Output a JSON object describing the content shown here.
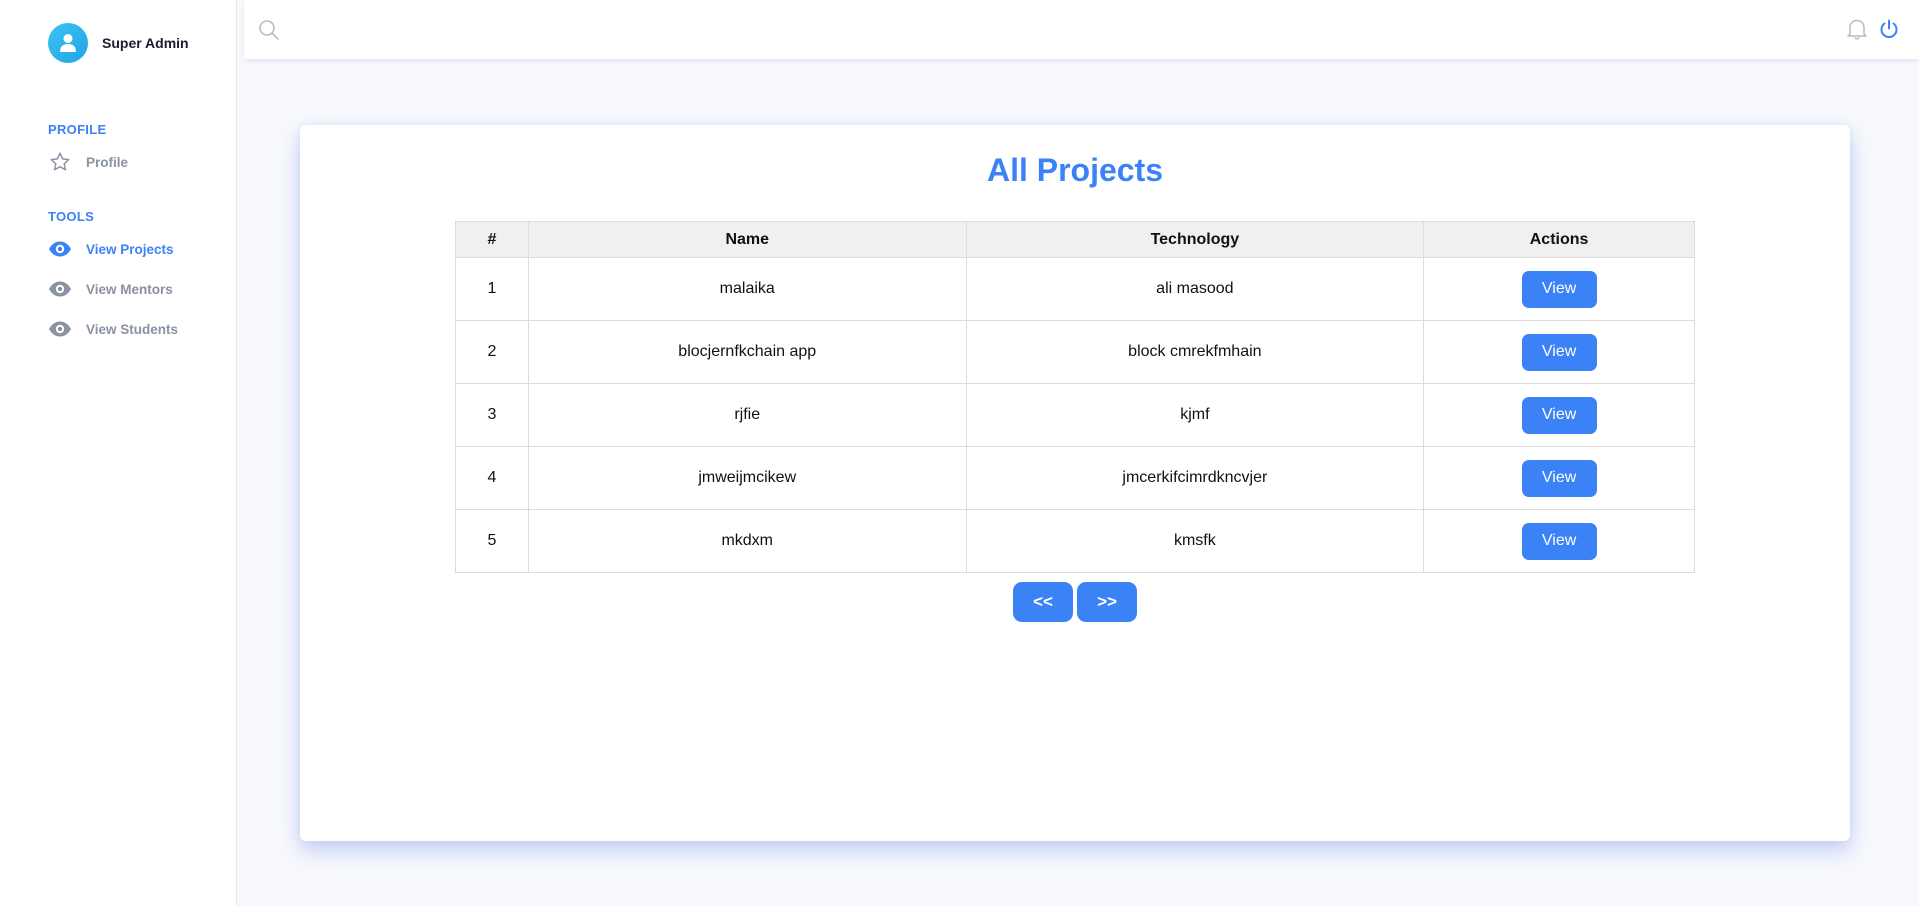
{
  "sidebar": {
    "user_name": "Super Admin",
    "sections": [
      {
        "title": "PROFILE"
      },
      {
        "title": "TOOLS"
      }
    ],
    "items": [
      {
        "label": "Profile",
        "icon": "star-icon",
        "active": false
      },
      {
        "label": "View Projects",
        "icon": "eye-icon",
        "active": true
      },
      {
        "label": "View Mentors",
        "icon": "eye-icon",
        "active": false
      },
      {
        "label": "View Students",
        "icon": "eye-icon",
        "active": false
      }
    ]
  },
  "topbar": {
    "icons": [
      "search-icon",
      "bell-icon",
      "power-icon"
    ]
  },
  "main": {
    "title": "All Projects",
    "table": {
      "headers": [
        "#",
        "Name",
        "Technology",
        "Actions"
      ],
      "rows": [
        {
          "num": "1",
          "name": "malaika",
          "technology": "ali masood",
          "action": "View"
        },
        {
          "num": "2",
          "name": "blocjernfkchain app",
          "technology": "block cmrekfmhain",
          "action": "View"
        },
        {
          "num": "3",
          "name": "rjfie",
          "technology": "kjmf",
          "action": "View"
        },
        {
          "num": "4",
          "name": "jmweijmcikew",
          "technology": "jmcerkifcimrdkncvjer",
          "action": "View"
        },
        {
          "num": "5",
          "name": "mkdxm",
          "technology": "kmsfk",
          "action": "View"
        }
      ]
    },
    "pagination": {
      "prev_label": "<<",
      "next_label": ">>"
    }
  },
  "colors": {
    "accent": "#3b82f6",
    "muted": "#8a91a3",
    "avatar": "#1fa4e8"
  }
}
